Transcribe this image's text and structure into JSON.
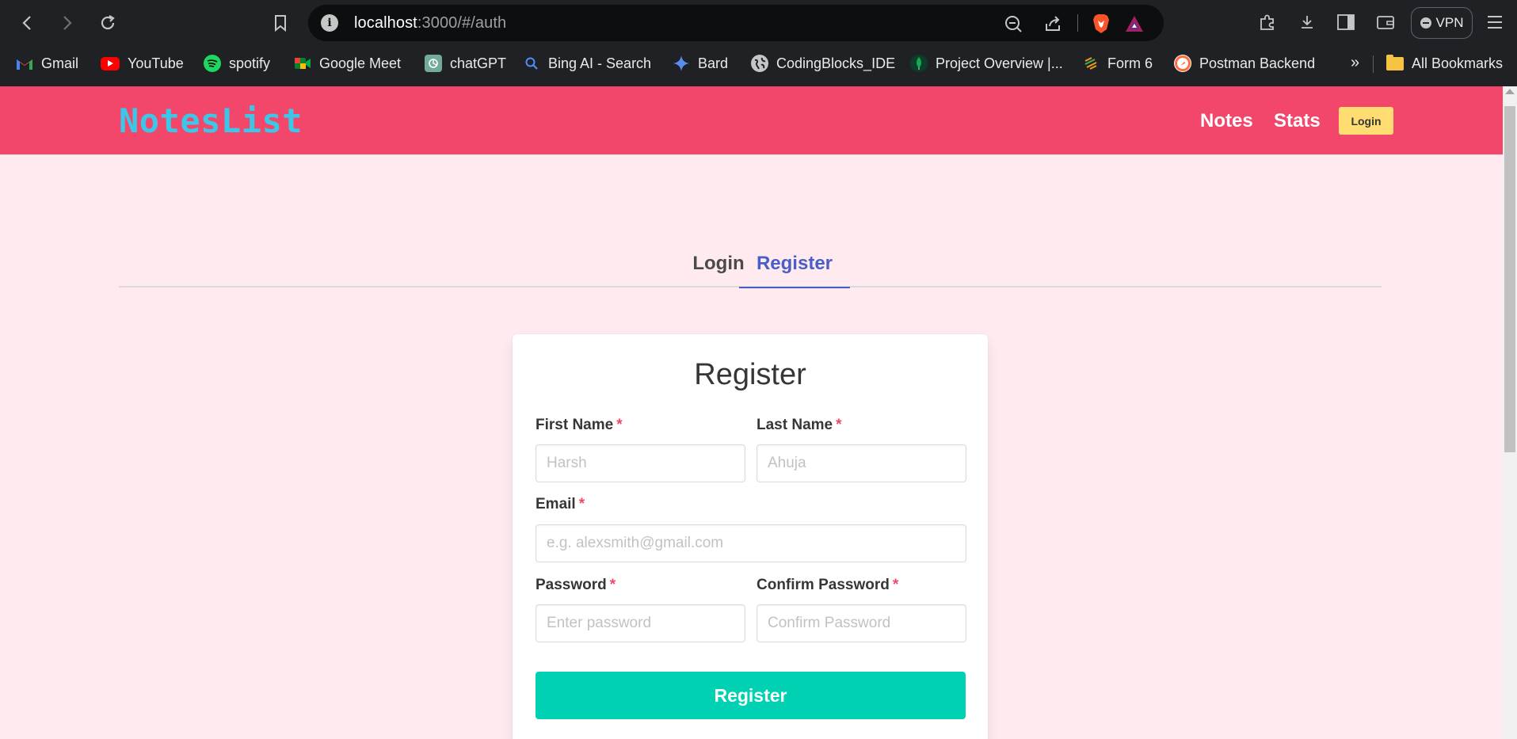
{
  "browser": {
    "url_host": "localhost",
    "url_rest": ":3000/#/auth",
    "vpn_label": "VPN",
    "bookmarks": [
      {
        "label": "Gmail",
        "icon": "gmail-icon"
      },
      {
        "label": "YouTube",
        "icon": "youtube-icon"
      },
      {
        "label": "spotify",
        "icon": "spotify-icon"
      },
      {
        "label": "Google Meet",
        "icon": "google-meet-icon"
      },
      {
        "label": "chatGPT",
        "icon": "chatgpt-icon"
      },
      {
        "label": "Bing AI - Search",
        "icon": "search-icon"
      },
      {
        "label": "Bard",
        "icon": "bard-icon"
      },
      {
        "label": "CodingBlocks_IDE",
        "icon": "globe-icon"
      },
      {
        "label": "Project Overview |...",
        "icon": "mongodb-icon"
      },
      {
        "label": "Form 6",
        "icon": "form-icon"
      },
      {
        "label": "Postman Backend",
        "icon": "postman-icon"
      }
    ],
    "more_label": "»",
    "all_bookmarks_label": "All Bookmarks"
  },
  "app": {
    "logo": "NotesList",
    "nav": {
      "notes_label": "Notes",
      "stats_label": "Stats",
      "login_label": "Login"
    },
    "tabs": [
      {
        "label": "Login",
        "active": false
      },
      {
        "label": "Register",
        "active": true
      }
    ],
    "form": {
      "title": "Register",
      "first_name": {
        "label": "First Name",
        "required_mark": "*",
        "placeholder": "Harsh",
        "value": ""
      },
      "last_name": {
        "label": "Last Name",
        "required_mark": "*",
        "placeholder": "Ahuja",
        "value": ""
      },
      "email": {
        "label": "Email",
        "required_mark": "*",
        "placeholder": "e.g. alexsmith@gmail.com",
        "value": ""
      },
      "password": {
        "label": "Password",
        "required_mark": "*",
        "placeholder": "Enter password",
        "value": ""
      },
      "confirm_password": {
        "label": "Confirm Password",
        "required_mark": "*",
        "placeholder": "Confirm Password",
        "value": ""
      },
      "submit_label": "Register"
    }
  },
  "colors": {
    "navbar": "#f2476a",
    "logo": "#3cc7e8",
    "login_button": "#ffdd73",
    "active_tab": "#485fc7",
    "submit_button": "#00d1b2",
    "page_background": "#ffeaef"
  }
}
